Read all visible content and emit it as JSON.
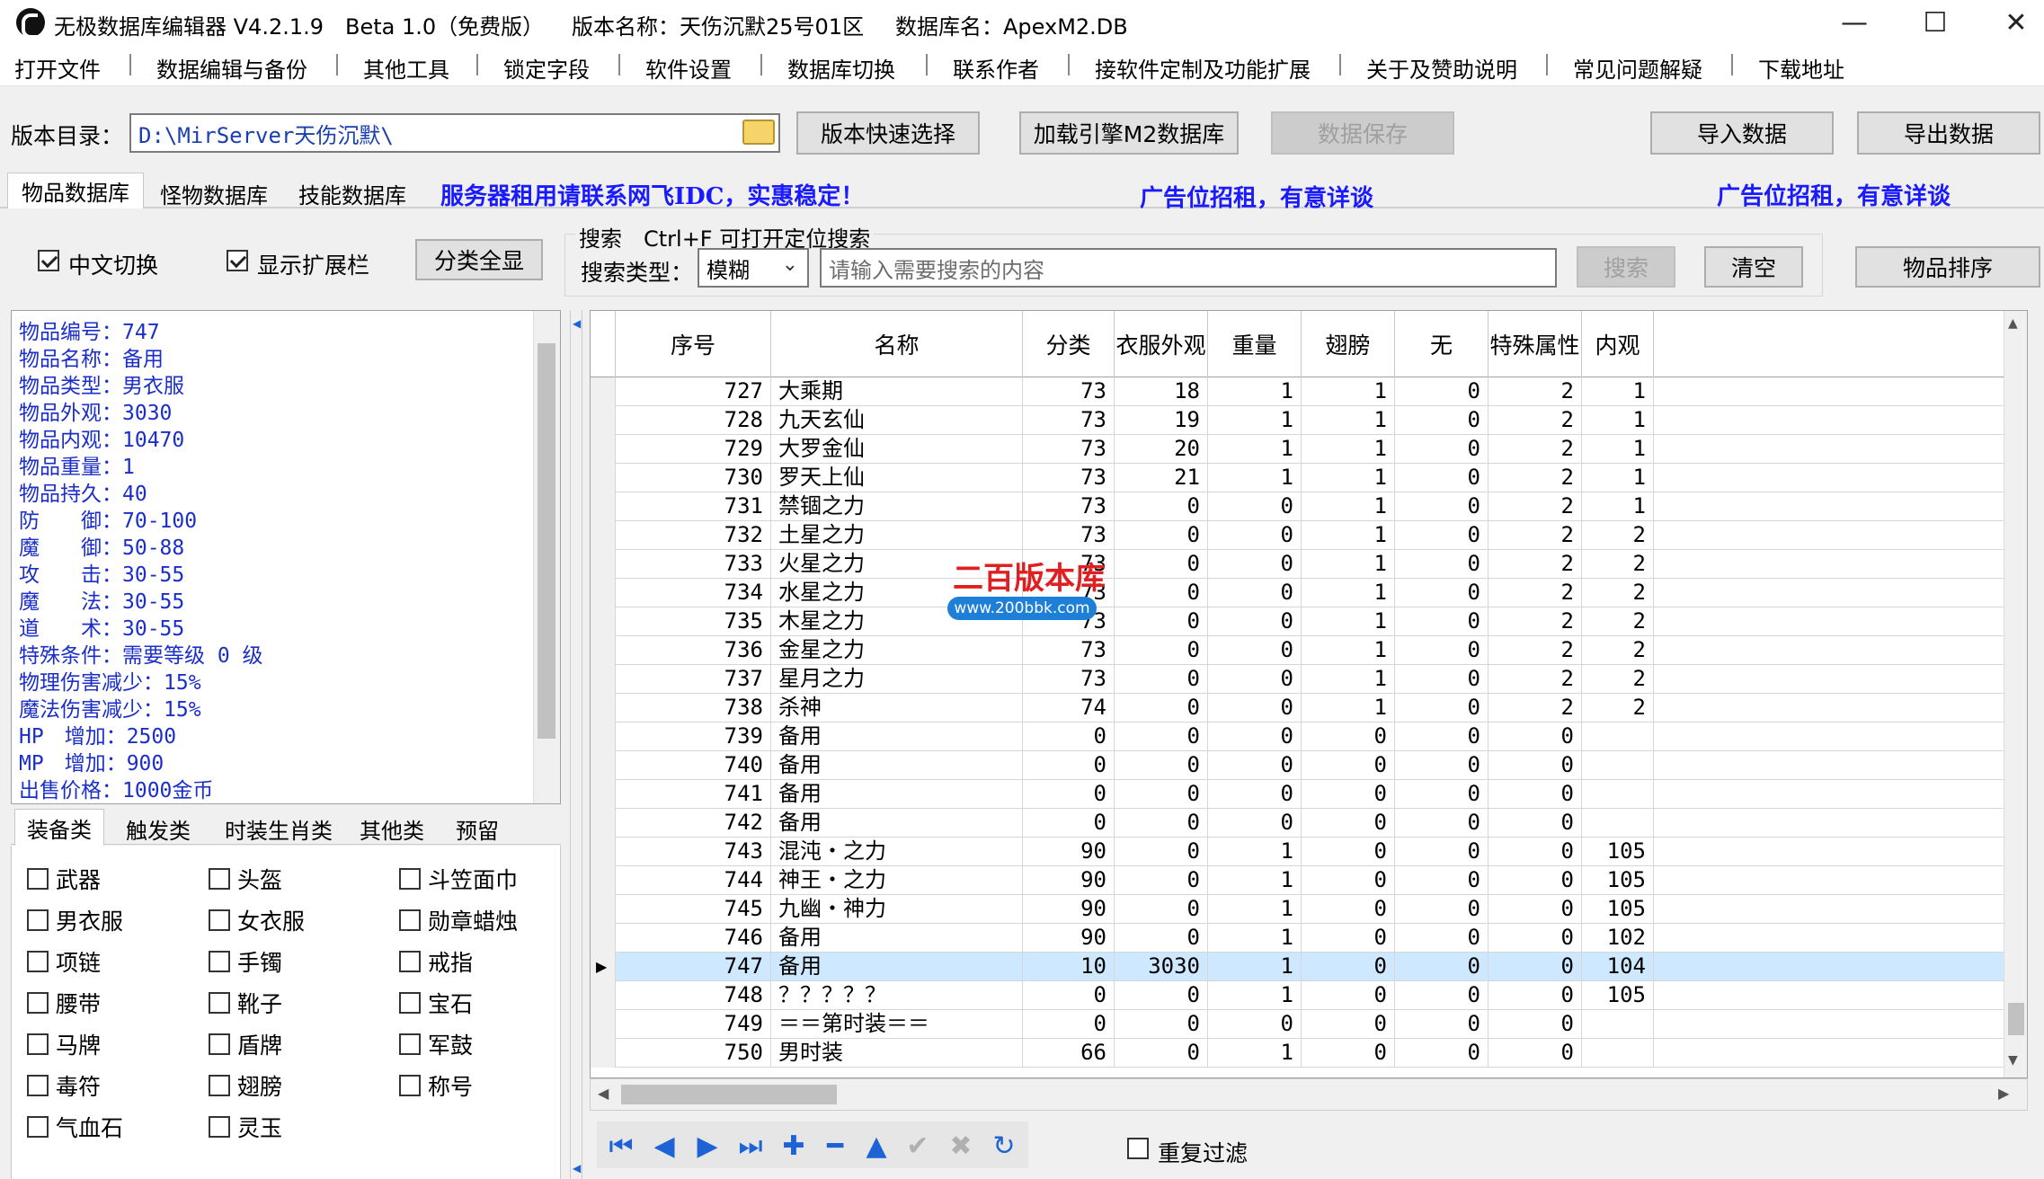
{
  "window": {
    "app_title": "无极数据库编辑器 V4.2.1.9",
    "beta": "Beta 1.0（免费版）",
    "version_name": "版本名称：天伤沉默25号01区",
    "db_name": "数据库名：ApexM2.DB",
    "minimize": "—",
    "maximize": "☐",
    "close": "✕"
  },
  "menu": [
    "打开文件",
    "数据编辑与备份",
    "其他工具",
    "锁定字段",
    "软件设置",
    "数据库切换",
    "联系作者",
    "接软件定制及功能扩展",
    "关于及赞助说明",
    "常见问题解疑",
    "下载地址"
  ],
  "toolbar": {
    "dir_label": "版本目录：",
    "dir_value": "D:\\MirServer天伤沉默\\",
    "quick_select": "版本快速选择",
    "load_m2": "加载引擎M2数据库",
    "save": "数据保存",
    "import": "导入数据",
    "export": "导出数据"
  },
  "db_tabs": [
    "物品数据库",
    "怪物数据库",
    "技能数据库"
  ],
  "ads": {
    "ad1": "服务器租用请联系网飞IDC，实惠稳定！",
    "ad2": "广告位招租，有意详谈",
    "ad3": "广告位招租，有意详谈"
  },
  "options": {
    "cn_switch": "中文切换",
    "show_ext": "显示扩展栏",
    "show_all": "分类全显"
  },
  "search": {
    "group_label": "搜索　Ctrl+F 可打开定位搜索",
    "type_label": "搜索类型：",
    "type_value": "模糊",
    "placeholder": "请输入需要搜索的内容",
    "search_btn": "搜索",
    "clear_btn": "清空",
    "sort_btn": "物品排序"
  },
  "item_info": [
    "物品编号：747",
    "物品名称：备用",
    "物品类型：男衣服",
    "物品外观：3030",
    "物品内观：10470",
    "物品重量：1",
    "物品持久：40",
    "防　　御：70-100",
    "魔　　御：50-88",
    "攻　　击：30-55",
    "魔　　法：30-55",
    "道　　术：30-55",
    "特殊条件：需要等级 0 级",
    "物理伤害减少：15%",
    "魔法伤害减少：15%",
    "HP　增加：2500",
    "MP　增加：900",
    "出售价格：1000金币"
  ],
  "cat_tabs": [
    "装备类",
    "触发类",
    "时装生肖类",
    "其他类",
    "预留"
  ],
  "categories": [
    "武器",
    "头盔",
    "斗笠面巾",
    "男衣服",
    "女衣服",
    "勋章蜡烛",
    "项链",
    "手镯",
    "戒指",
    "腰带",
    "靴子",
    "宝石",
    "马牌",
    "盾牌",
    "军鼓",
    "毒符",
    "翅膀",
    "称号",
    "气血石",
    "灵玉"
  ],
  "watermark": {
    "title": "二百版本库",
    "url": "www.200bbk.com"
  },
  "grid": {
    "columns": [
      "序号",
      "名称",
      "分类",
      "衣服外观",
      "重量",
      "翅膀",
      "无",
      "特殊属性",
      "内观"
    ],
    "rows": [
      [
        "727",
        "大乘期",
        "73",
        "18",
        "1",
        "1",
        "0",
        "2",
        "1"
      ],
      [
        "728",
        "九天玄仙",
        "73",
        "19",
        "1",
        "1",
        "0",
        "2",
        "1"
      ],
      [
        "729",
        "大罗金仙",
        "73",
        "20",
        "1",
        "1",
        "0",
        "2",
        "1"
      ],
      [
        "730",
        "罗天上仙",
        "73",
        "21",
        "1",
        "1",
        "0",
        "2",
        "1"
      ],
      [
        "731",
        "禁锢之力",
        "73",
        "0",
        "0",
        "1",
        "0",
        "2",
        "1"
      ],
      [
        "732",
        "土星之力",
        "73",
        "0",
        "0",
        "1",
        "0",
        "2",
        "2"
      ],
      [
        "733",
        "火星之力",
        "73",
        "0",
        "0",
        "1",
        "0",
        "2",
        "2"
      ],
      [
        "734",
        "水星之力",
        "73",
        "0",
        "0",
        "1",
        "0",
        "2",
        "2"
      ],
      [
        "735",
        "木星之力",
        "73",
        "0",
        "0",
        "1",
        "0",
        "2",
        "2"
      ],
      [
        "736",
        "金星之力",
        "73",
        "0",
        "0",
        "1",
        "0",
        "2",
        "2"
      ],
      [
        "737",
        "星月之力",
        "73",
        "0",
        "0",
        "1",
        "0",
        "2",
        "2"
      ],
      [
        "738",
        "杀神",
        "74",
        "0",
        "0",
        "1",
        "0",
        "2",
        "2"
      ],
      [
        "739",
        "备用",
        "0",
        "0",
        "0",
        "0",
        "0",
        "0",
        ""
      ],
      [
        "740",
        "备用",
        "0",
        "0",
        "0",
        "0",
        "0",
        "0",
        ""
      ],
      [
        "741",
        "备用",
        "0",
        "0",
        "0",
        "0",
        "0",
        "0",
        ""
      ],
      [
        "742",
        "备用",
        "0",
        "0",
        "0",
        "0",
        "0",
        "0",
        ""
      ],
      [
        "743",
        "混沌・之力",
        "90",
        "0",
        "1",
        "0",
        "0",
        "0",
        "105"
      ],
      [
        "744",
        "神王・之力",
        "90",
        "0",
        "1",
        "0",
        "0",
        "0",
        "105"
      ],
      [
        "745",
        "九幽・神力",
        "90",
        "0",
        "1",
        "0",
        "0",
        "0",
        "105"
      ],
      [
        "746",
        "备用",
        "90",
        "0",
        "1",
        "0",
        "0",
        "0",
        "102"
      ],
      [
        "747",
        "备用",
        "10",
        "3030",
        "1",
        "0",
        "0",
        "0",
        "104"
      ],
      [
        "748",
        "？？？？？",
        "0",
        "0",
        "1",
        "0",
        "0",
        "0",
        "105"
      ],
      [
        "749",
        "＝＝第时装＝＝",
        "0",
        "0",
        "0",
        "0",
        "0",
        "0",
        ""
      ],
      [
        "750",
        "男时装",
        "66",
        "0",
        "1",
        "0",
        "0",
        "0",
        ""
      ]
    ],
    "selected_index": 20
  },
  "nav": {
    "repeat_filter": "重复过滤"
  }
}
